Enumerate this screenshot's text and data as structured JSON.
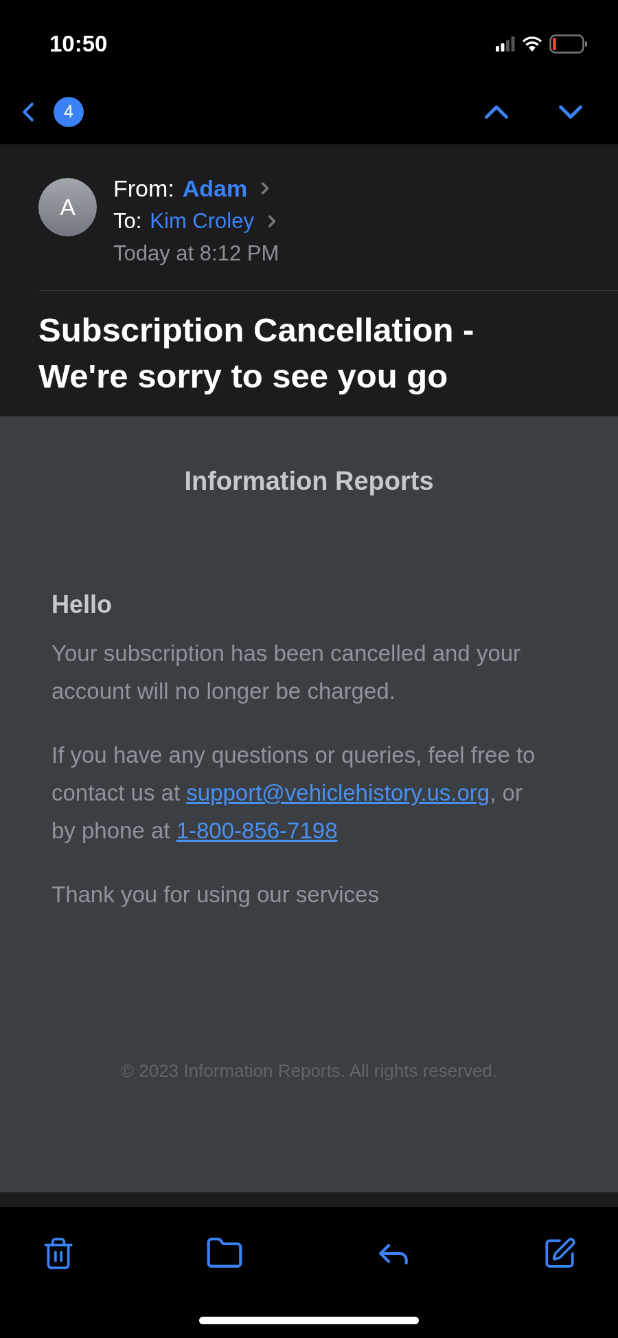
{
  "status_bar": {
    "time": "10:50"
  },
  "nav": {
    "unread_count": "4"
  },
  "header": {
    "avatar_initial": "A",
    "from_label": "From:",
    "sender": "Adam",
    "to_label": "To:",
    "recipient": "Kim Croley",
    "date": "Today at 8:12 PM",
    "subject": "Subscription Cancellation - We're sorry to see you go"
  },
  "body": {
    "brand": "Information Reports",
    "greeting": "Hello",
    "paragraphs": [
      [
        {
          "kind": "text",
          "text": "Your subscription has been cancelled and your account will no longer be charged."
        }
      ],
      [
        {
          "kind": "text",
          "text": "If you have any questions or queries, feel free to contact us at "
        },
        {
          "kind": "link",
          "text": "support@vehiclehistory.us.org"
        },
        {
          "kind": "text",
          "text": ", or by phone at "
        },
        {
          "kind": "link",
          "text": "1-800-856-7198"
        }
      ],
      [
        {
          "kind": "text",
          "text": "Thank you for using our services"
        }
      ]
    ],
    "footer": "© 2023 Information Reports. All rights reserved."
  }
}
